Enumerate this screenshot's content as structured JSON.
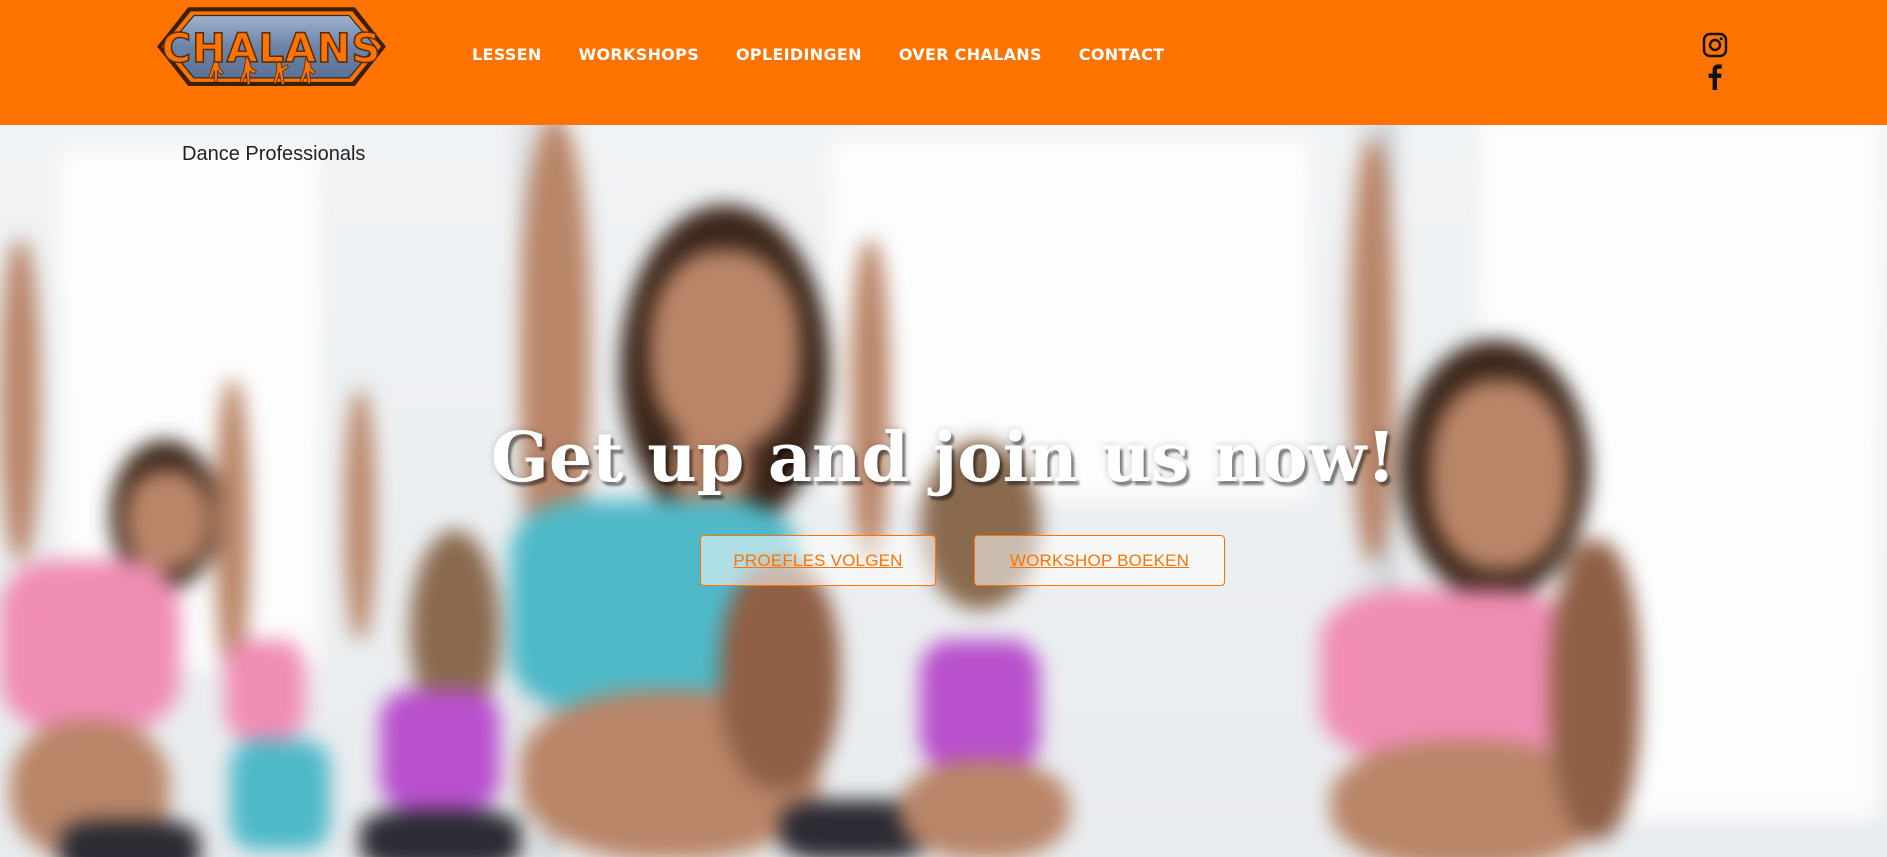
{
  "brand": {
    "logo_text": "CHALANS",
    "tagline": "Dance Professionals",
    "accent_color": "#ff7400"
  },
  "nav": {
    "items": [
      {
        "label": "LESSEN"
      },
      {
        "label": "WORKSHOPS"
      },
      {
        "label": "OPLEIDINGEN"
      },
      {
        "label": "OVER CHALANS"
      },
      {
        "label": "CONTACT"
      }
    ]
  },
  "social": {
    "icons": [
      "instagram-icon",
      "facebook-icon"
    ]
  },
  "hero": {
    "headline": "Get up and join us now!",
    "buttons": [
      {
        "label": "PROEFLES VOLGEN"
      },
      {
        "label": "WORKSHOP BOEKEN"
      }
    ]
  }
}
